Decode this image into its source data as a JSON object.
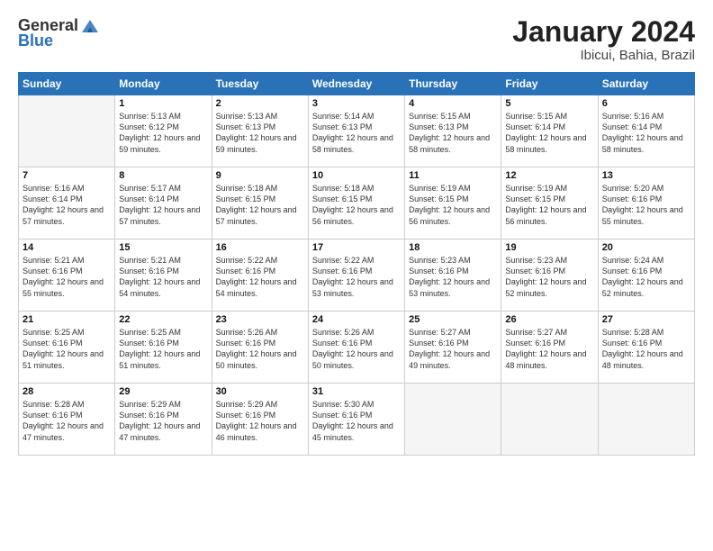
{
  "header": {
    "logo_general": "General",
    "logo_blue": "Blue",
    "title": "January 2024",
    "subtitle": "Ibicui, Bahia, Brazil"
  },
  "calendar": {
    "days_of_week": [
      "Sunday",
      "Monday",
      "Tuesday",
      "Wednesday",
      "Thursday",
      "Friday",
      "Saturday"
    ],
    "weeks": [
      [
        {
          "day": "",
          "empty": true
        },
        {
          "day": "1",
          "sunrise": "5:13 AM",
          "sunset": "6:12 PM",
          "daylight": "12 hours and 59 minutes."
        },
        {
          "day": "2",
          "sunrise": "5:13 AM",
          "sunset": "6:13 PM",
          "daylight": "12 hours and 59 minutes."
        },
        {
          "day": "3",
          "sunrise": "5:14 AM",
          "sunset": "6:13 PM",
          "daylight": "12 hours and 58 minutes."
        },
        {
          "day": "4",
          "sunrise": "5:15 AM",
          "sunset": "6:13 PM",
          "daylight": "12 hours and 58 minutes."
        },
        {
          "day": "5",
          "sunrise": "5:15 AM",
          "sunset": "6:14 PM",
          "daylight": "12 hours and 58 minutes."
        },
        {
          "day": "6",
          "sunrise": "5:16 AM",
          "sunset": "6:14 PM",
          "daylight": "12 hours and 58 minutes."
        }
      ],
      [
        {
          "day": "7",
          "sunrise": "5:16 AM",
          "sunset": "6:14 PM",
          "daylight": "12 hours and 57 minutes."
        },
        {
          "day": "8",
          "sunrise": "5:17 AM",
          "sunset": "6:14 PM",
          "daylight": "12 hours and 57 minutes."
        },
        {
          "day": "9",
          "sunrise": "5:18 AM",
          "sunset": "6:15 PM",
          "daylight": "12 hours and 57 minutes."
        },
        {
          "day": "10",
          "sunrise": "5:18 AM",
          "sunset": "6:15 PM",
          "daylight": "12 hours and 56 minutes."
        },
        {
          "day": "11",
          "sunrise": "5:19 AM",
          "sunset": "6:15 PM",
          "daylight": "12 hours and 56 minutes."
        },
        {
          "day": "12",
          "sunrise": "5:19 AM",
          "sunset": "6:15 PM",
          "daylight": "12 hours and 56 minutes."
        },
        {
          "day": "13",
          "sunrise": "5:20 AM",
          "sunset": "6:16 PM",
          "daylight": "12 hours and 55 minutes."
        }
      ],
      [
        {
          "day": "14",
          "sunrise": "5:21 AM",
          "sunset": "6:16 PM",
          "daylight": "12 hours and 55 minutes."
        },
        {
          "day": "15",
          "sunrise": "5:21 AM",
          "sunset": "6:16 PM",
          "daylight": "12 hours and 54 minutes."
        },
        {
          "day": "16",
          "sunrise": "5:22 AM",
          "sunset": "6:16 PM",
          "daylight": "12 hours and 54 minutes."
        },
        {
          "day": "17",
          "sunrise": "5:22 AM",
          "sunset": "6:16 PM",
          "daylight": "12 hours and 53 minutes."
        },
        {
          "day": "18",
          "sunrise": "5:23 AM",
          "sunset": "6:16 PM",
          "daylight": "12 hours and 53 minutes."
        },
        {
          "day": "19",
          "sunrise": "5:23 AM",
          "sunset": "6:16 PM",
          "daylight": "12 hours and 52 minutes."
        },
        {
          "day": "20",
          "sunrise": "5:24 AM",
          "sunset": "6:16 PM",
          "daylight": "12 hours and 52 minutes."
        }
      ],
      [
        {
          "day": "21",
          "sunrise": "5:25 AM",
          "sunset": "6:16 PM",
          "daylight": "12 hours and 51 minutes."
        },
        {
          "day": "22",
          "sunrise": "5:25 AM",
          "sunset": "6:16 PM",
          "daylight": "12 hours and 51 minutes."
        },
        {
          "day": "23",
          "sunrise": "5:26 AM",
          "sunset": "6:16 PM",
          "daylight": "12 hours and 50 minutes."
        },
        {
          "day": "24",
          "sunrise": "5:26 AM",
          "sunset": "6:16 PM",
          "daylight": "12 hours and 50 minutes."
        },
        {
          "day": "25",
          "sunrise": "5:27 AM",
          "sunset": "6:16 PM",
          "daylight": "12 hours and 49 minutes."
        },
        {
          "day": "26",
          "sunrise": "5:27 AM",
          "sunset": "6:16 PM",
          "daylight": "12 hours and 48 minutes."
        },
        {
          "day": "27",
          "sunrise": "5:28 AM",
          "sunset": "6:16 PM",
          "daylight": "12 hours and 48 minutes."
        }
      ],
      [
        {
          "day": "28",
          "sunrise": "5:28 AM",
          "sunset": "6:16 PM",
          "daylight": "12 hours and 47 minutes."
        },
        {
          "day": "29",
          "sunrise": "5:29 AM",
          "sunset": "6:16 PM",
          "daylight": "12 hours and 47 minutes."
        },
        {
          "day": "30",
          "sunrise": "5:29 AM",
          "sunset": "6:16 PM",
          "daylight": "12 hours and 46 minutes."
        },
        {
          "day": "31",
          "sunrise": "5:30 AM",
          "sunset": "6:16 PM",
          "daylight": "12 hours and 45 minutes."
        },
        {
          "day": "",
          "empty": true
        },
        {
          "day": "",
          "empty": true
        },
        {
          "day": "",
          "empty": true
        }
      ]
    ]
  }
}
